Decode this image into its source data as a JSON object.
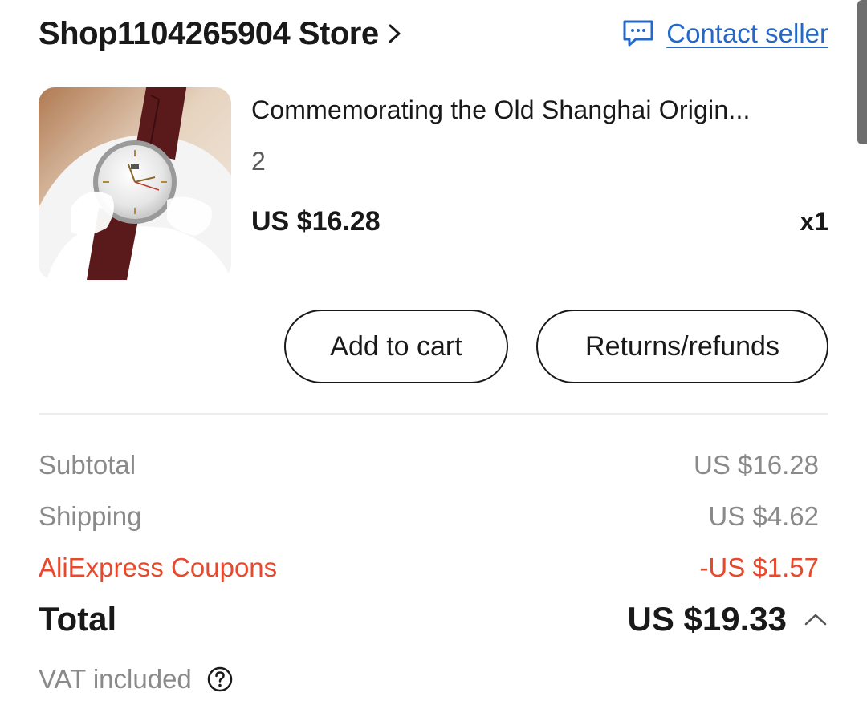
{
  "store": {
    "name": "Shop1104265904 Store",
    "contact_label": "Contact seller"
  },
  "product": {
    "title": "Commemorating the Old Shanghai Origin...",
    "variant": "2",
    "price": "US $16.28",
    "quantity": "x1",
    "image": "wristwatch-photo"
  },
  "actions": {
    "add_to_cart": "Add to cart",
    "returns": "Returns/refunds"
  },
  "summary": {
    "subtotal_label": "Subtotal",
    "subtotal_value": "US $16.28",
    "shipping_label": "Shipping",
    "shipping_value": "US $4.62",
    "coupons_label": "AliExpress Coupons",
    "coupons_value": "-US $1.57",
    "total_label": "Total",
    "total_value": "US $19.33",
    "vat_label": "VAT included"
  },
  "icons": {
    "store": "chevron-right-icon",
    "contact": "chat-icon",
    "total": "chevron-up-icon",
    "vat": "help-icon"
  },
  "colors": {
    "link": "#2469c8",
    "coupon": "#e8482c",
    "muted": "#8a8a8a",
    "text": "#191919"
  }
}
